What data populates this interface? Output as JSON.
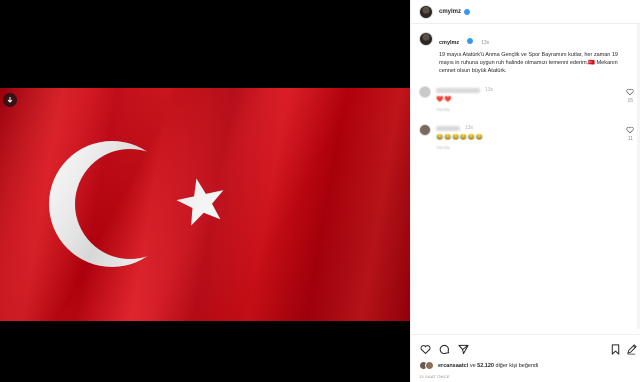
{
  "post": {
    "username": "cmylmz",
    "time": "13s",
    "caption": "19 mayıs Atatürk'ü Anma Gençlik ve Spor Bayramını kutlar, her zaman 19 mayıs in ruhuna uygun ruh halinde olmamızı temenni ederim.🇹🇷 Mekanın cennet olsun büyük Atatürk."
  },
  "comments": [
    {
      "time": "13s",
      "emojis": "❤️❤️",
      "reply": "Yanıtla",
      "likes": "15"
    },
    {
      "time": "13s",
      "emojis": "😂😂😂😂😂😂",
      "reply": "Yanıtla",
      "likes": "11"
    }
  ],
  "likes": {
    "first_user": "ercansaatci",
    "text_mid": "ve",
    "count": "52.120",
    "text_end": "diğer kişi beğendi"
  },
  "date_label": "13 SAAT ÖNCE",
  "icons": {
    "media": "download-arrow-icon",
    "like": "heart-icon",
    "comment": "comment-icon",
    "share": "send-icon",
    "save": "bookmark-icon",
    "edit": "edit-icon"
  },
  "colors": {
    "flag_red": "#d9141c",
    "verified": "#3897f0"
  }
}
